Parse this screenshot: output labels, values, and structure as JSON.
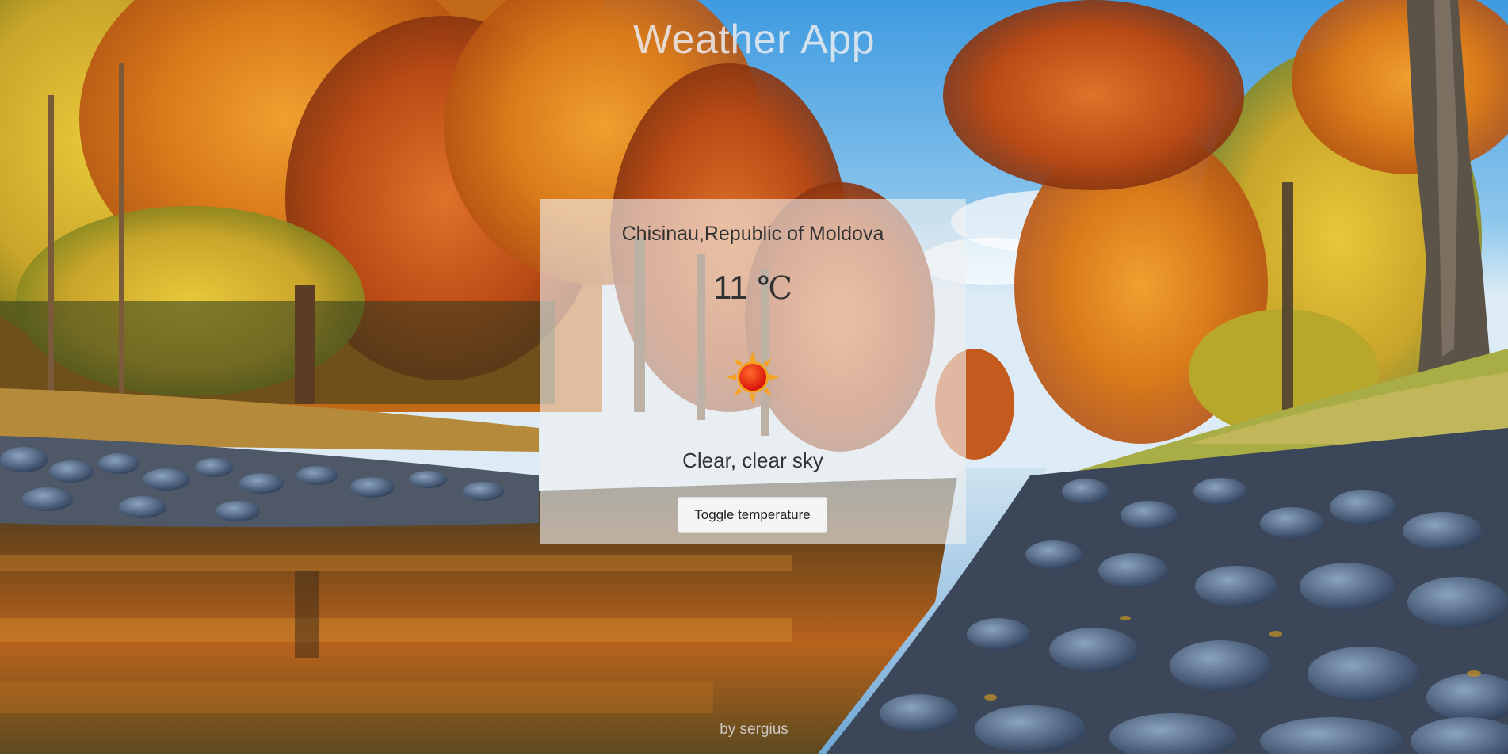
{
  "app": {
    "title": "Weather App",
    "footer": "by sergius"
  },
  "weather": {
    "location": "Chisinau,Republic of Moldova",
    "temperature": "11",
    "unit": "℃",
    "icon": "sun-icon",
    "condition": "Clear, clear sky"
  },
  "controls": {
    "toggle_label": "Toggle temperature"
  },
  "colors": {
    "card_background": "#f0f0f0",
    "text": "#333333",
    "sun_core": "#e8170c",
    "sun_rays": "#f5a321"
  }
}
